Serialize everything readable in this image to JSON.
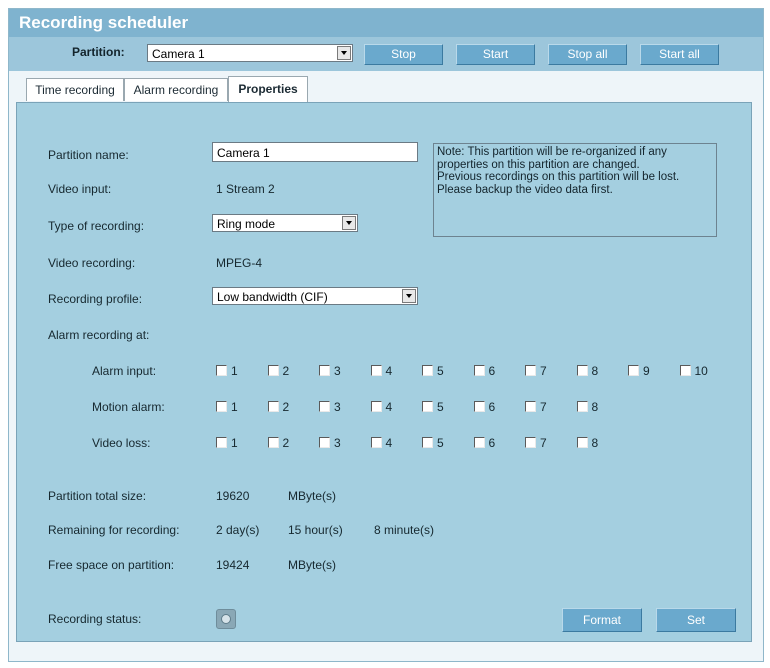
{
  "window": {
    "title": "Recording scheduler"
  },
  "toolbar": {
    "partition_label": "Partition:",
    "partition_value": "Camera 1",
    "stop_label": "Stop",
    "start_label": "Start",
    "stop_all_label": "Stop all",
    "start_all_label": "Start all"
  },
  "tabs": [
    {
      "label": "Time recording",
      "active": false
    },
    {
      "label": "Alarm recording",
      "active": false
    },
    {
      "label": "Properties",
      "active": true
    }
  ],
  "form": {
    "partition_name_label": "Partition name:",
    "partition_name_value": "Camera 1",
    "video_input_label": "Video input:",
    "video_input_value": "1 Stream 2",
    "type_label": "Type of recording:",
    "type_value": "Ring mode",
    "video_recording_label": "Video recording:",
    "video_recording_value": "MPEG-4",
    "profile_label": "Recording profile:",
    "profile_value": "Low bandwidth (CIF)",
    "alarm_recording_label": "Alarm recording at:",
    "alarm_input_label": "Alarm input:",
    "motion_alarm_label": "Motion alarm:",
    "video_loss_label": "Video loss:",
    "alarm_inputs": [
      "1",
      "2",
      "3",
      "4",
      "5",
      "6",
      "7",
      "8",
      "9",
      "10"
    ],
    "motion_alarms": [
      "1",
      "2",
      "3",
      "4",
      "5",
      "6",
      "7",
      "8"
    ],
    "video_losses": [
      "1",
      "2",
      "3",
      "4",
      "5",
      "6",
      "7",
      "8"
    ],
    "total_size_label": "Partition total size:",
    "total_size_value": "19620",
    "total_size_unit": "MByte(s)",
    "remaining_label": "Remaining for recording:",
    "remaining_days": "2 day(s)",
    "remaining_hours": "15 hour(s)",
    "remaining_minutes": "8 minute(s)",
    "free_space_label": "Free space on partition:",
    "free_space_value": "19424",
    "free_space_unit": "MByte(s)",
    "status_label": "Recording status:",
    "status_icon": "recording-status-icon"
  },
  "note": {
    "line1": "Note: This partition will be re-organized if any",
    "line2": "properties on this partition are changed.",
    "line3": "Previous recordings on this partition will be lost.",
    "line4": "Please backup the video data first."
  },
  "actions": {
    "format_label": "Format",
    "set_label": "Set"
  },
  "colors": {
    "title_bar": "#7fb3cf",
    "panel": "#a4cfe0",
    "button": "#6aa9cd"
  }
}
